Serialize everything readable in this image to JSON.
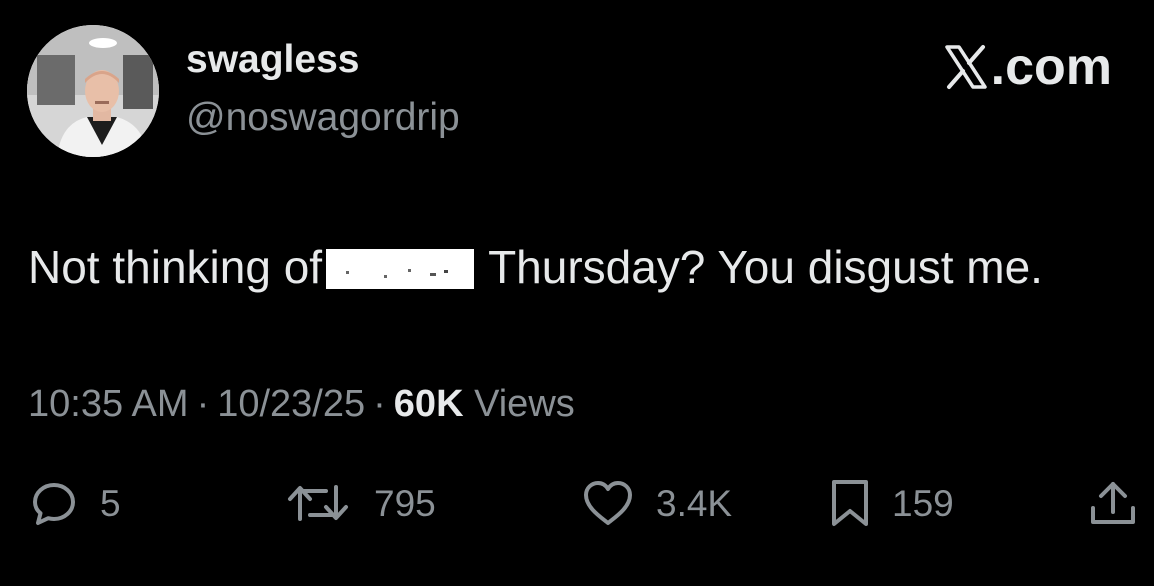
{
  "author": {
    "display_name": "swagless",
    "handle": "@noswagordrip"
  },
  "brand": {
    "label": ".com",
    "icon": "x-logo-icon"
  },
  "tweet": {
    "text_before": "Not thinking of",
    "text_after": "Thursday? You disgust me."
  },
  "meta": {
    "time": "10:35 AM",
    "separator": "·",
    "date": "10/23/25",
    "views_count": "60K",
    "views_label": "Views"
  },
  "actions": {
    "replies": "5",
    "reposts": "795",
    "likes": "3.4K",
    "bookmarks": "159"
  },
  "colors": {
    "background": "#000000",
    "primary_text": "#e7e9ea",
    "secondary_text": "#8b9196"
  }
}
